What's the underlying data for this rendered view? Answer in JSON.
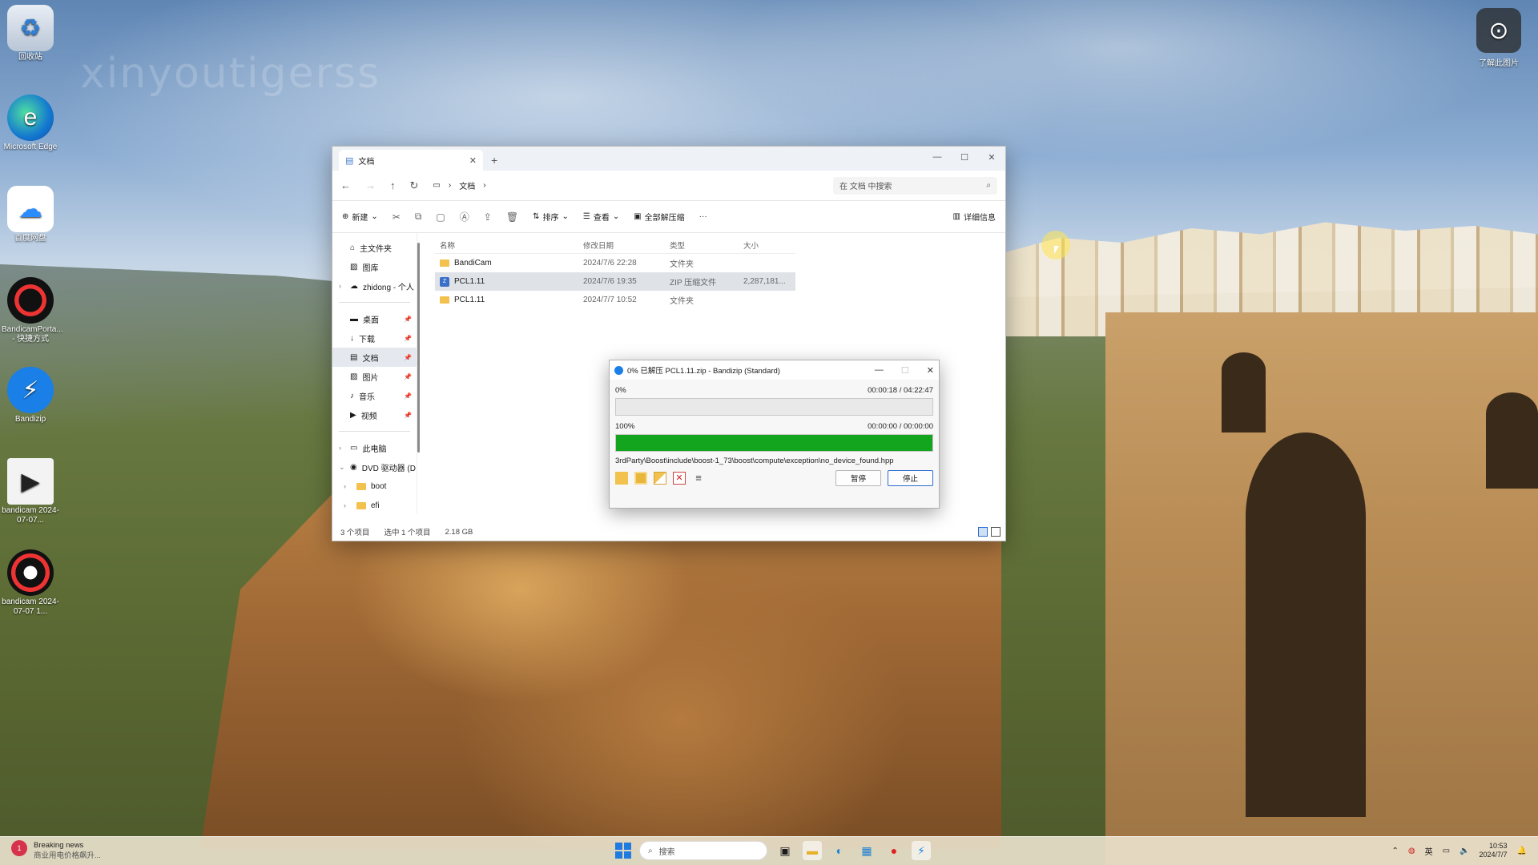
{
  "desktop": {
    "watermark": "xinyoutigerss",
    "icons": [
      {
        "label": "回收站"
      },
      {
        "label": "Microsoft Edge"
      },
      {
        "label": "百度网盘"
      },
      {
        "label": "BandicamPorta... - 快捷方式"
      },
      {
        "label": "Bandizip"
      },
      {
        "label": "bandicam 2024-07-07..."
      },
      {
        "label": "bandicam 2024-07-07 1..."
      }
    ],
    "top_right_widget": {
      "label": "了解此图片"
    }
  },
  "explorer": {
    "tab_title": "文档",
    "breadcrumb": [
      "文档"
    ],
    "search_placeholder": "在 文档 中搜索",
    "toolbar": {
      "new": "新建",
      "sort": "排序",
      "view": "查看",
      "extract_all": "全部解压缩",
      "more": "···",
      "details": "详细信息"
    },
    "sidebar": [
      {
        "label": "主文件夹"
      },
      {
        "label": "图库"
      },
      {
        "label": "zhidong - 个人"
      },
      {
        "label": "桌面"
      },
      {
        "label": "下载"
      },
      {
        "label": "文档"
      },
      {
        "label": "图片"
      },
      {
        "label": "音乐"
      },
      {
        "label": "视频"
      },
      {
        "label": "此电脑"
      },
      {
        "label": "DVD 驱动器 (D"
      },
      {
        "label": "boot"
      },
      {
        "label": "efi"
      }
    ],
    "columns": {
      "name": "名称",
      "date": "修改日期",
      "type": "类型",
      "size": "大小"
    },
    "rows": [
      {
        "name": "BandiCam",
        "date": "2024/7/6 22:28",
        "type": "文件夹",
        "size": ""
      },
      {
        "name": "PCL1.11",
        "date": "2024/7/6 19:35",
        "type": "ZIP 压缩文件",
        "size": "2,287,181..."
      },
      {
        "name": "PCL1.11",
        "date": "2024/7/7 10:52",
        "type": "文件夹",
        "size": ""
      }
    ],
    "status": {
      "count": "3 个项目",
      "selected": "选中 1 个项目",
      "size": "2.18 GB"
    }
  },
  "bandizip": {
    "title": "0% 已解压 PCL1.11.zip - Bandizip (Standard)",
    "overall_percent_label": "0%",
    "overall_time": "00:00:18 / 04:22:47",
    "overall_progress": 0.0,
    "file_percent_label": "100%",
    "file_time": "00:00:00 / 00:00:00",
    "file_progress": 1.0,
    "current_file": "3rdParty\\Boost\\include\\boost-1_73\\boost\\compute\\exception\\no_device_found.hpp",
    "pause_label": "暂停",
    "stop_label": "停止",
    "progress_color": "#13a51e"
  },
  "taskbar": {
    "news_title": "Breaking news",
    "news_sub": "商业用电价格飙升...",
    "search_label": "搜索",
    "ime": "英",
    "time": "10:53",
    "date": "2024/7/7"
  }
}
